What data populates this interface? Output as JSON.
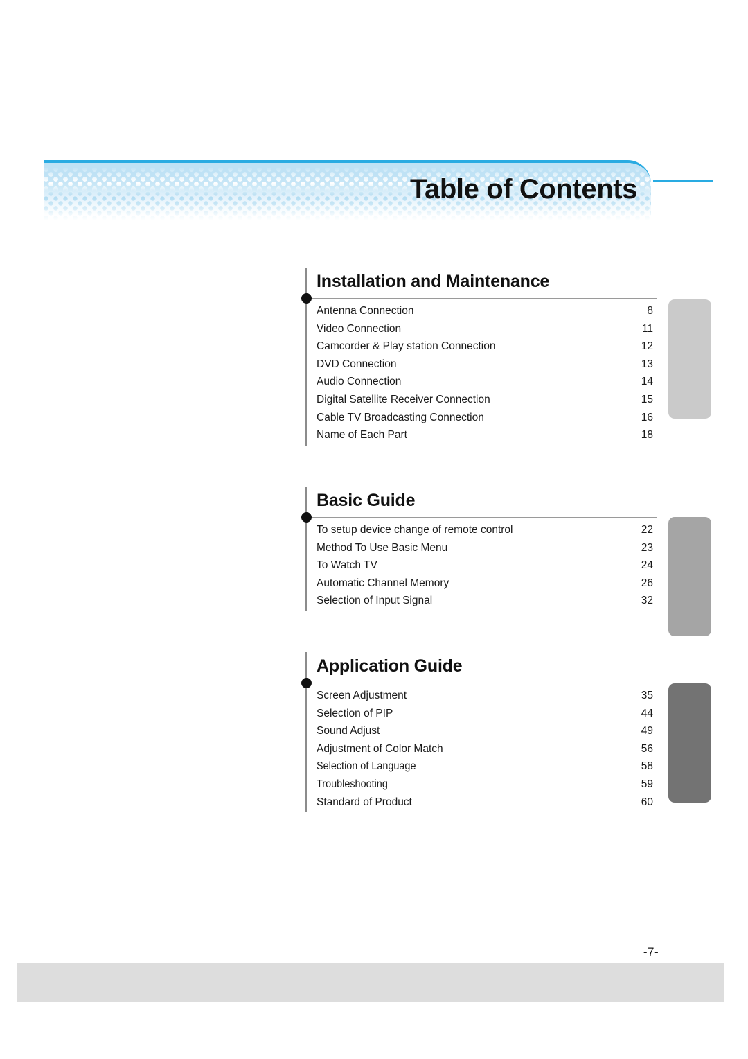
{
  "header": {
    "title": "Table of Contents",
    "accent_color": "#29abe2",
    "banner_color": "#bfe2f5"
  },
  "sections": [
    {
      "heading": "Installation and Maintenance",
      "tab_color": "#cacaca",
      "entries": [
        {
          "label": "Antenna Connection",
          "page": "8"
        },
        {
          "label": "Video Connection",
          "page": "11"
        },
        {
          "label": "Camcorder & Play station Connection",
          "page": "12"
        },
        {
          "label": "DVD Connection",
          "page": "13"
        },
        {
          "label": "Audio Connection",
          "page": "14"
        },
        {
          "label": "Digital Satellite Receiver Connection",
          "page": "15"
        },
        {
          "label": "Cable TV Broadcasting Connection",
          "page": "16"
        },
        {
          "label": "Name of Each Part",
          "page": "18"
        }
      ]
    },
    {
      "heading": "Basic Guide",
      "tab_color": "#a5a5a5",
      "entries": [
        {
          "label": "To setup device change of remote control",
          "page": "22"
        },
        {
          "label": "Method To Use Basic Menu",
          "page": "23"
        },
        {
          "label": "To Watch TV",
          "page": "24"
        },
        {
          "label": "Automatic Channel Memory",
          "page": "26"
        },
        {
          "label": "Selection of Input Signal",
          "page": "32"
        }
      ]
    },
    {
      "heading": "Application Guide",
      "tab_color": "#737373",
      "entries": [
        {
          "label": "Screen Adjustment",
          "page": "35"
        },
        {
          "label": "Selection of PIP",
          "page": "44"
        },
        {
          "label": "Sound Adjust",
          "page": "49"
        },
        {
          "label": "Adjustment of Color Match",
          "page": "56"
        },
        {
          "label": "Selection of Language",
          "page": "58",
          "condensed": true
        },
        {
          "label": "Troubleshooting",
          "page": "59",
          "condensed": true
        },
        {
          "label": "Standard of Product",
          "page": "60"
        }
      ]
    }
  ],
  "footer": {
    "page_number": "-7-"
  }
}
